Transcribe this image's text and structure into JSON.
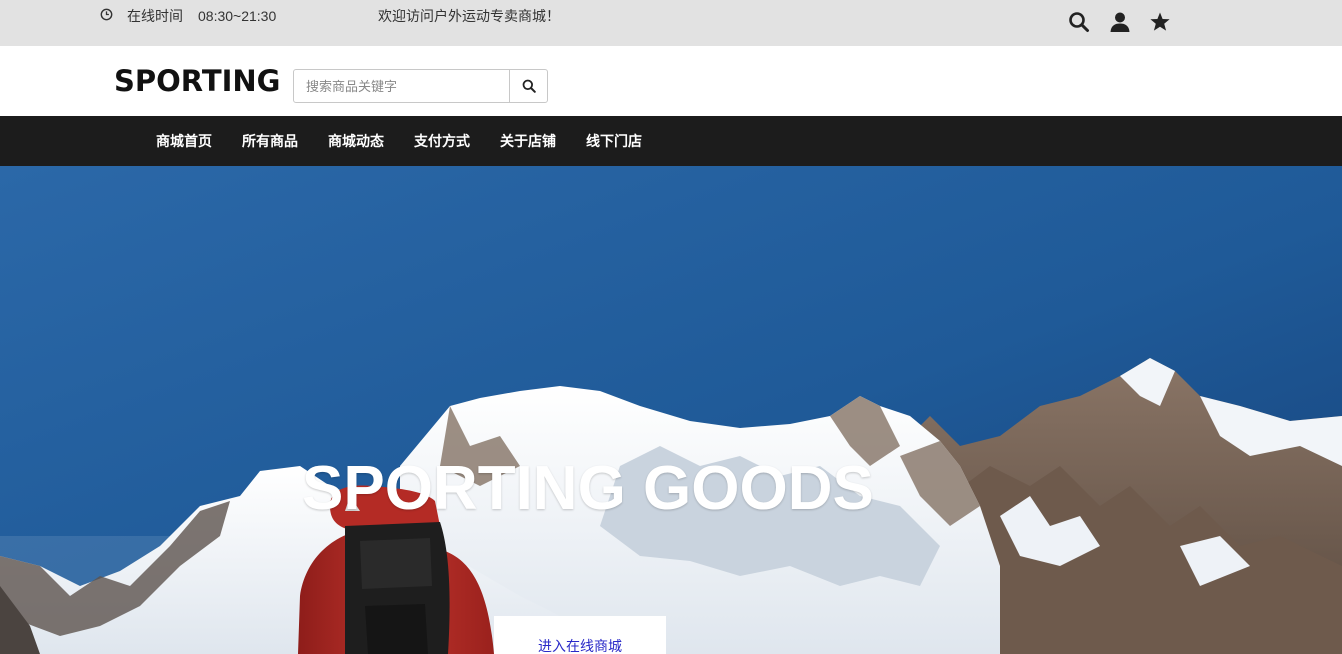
{
  "topbar": {
    "hours_label": "在线时间",
    "hours_value": "08:30~21:30",
    "welcome": "欢迎访问户外运动专卖商城！",
    "icons": [
      "clock-icon",
      "search-icon",
      "user-icon",
      "star-icon"
    ]
  },
  "header": {
    "logo": "SPORTING",
    "search": {
      "placeholder": "搜索商品关键字",
      "value": ""
    }
  },
  "nav": {
    "items": [
      "商城首页",
      "所有商品",
      "商城动态",
      "支付方式",
      "关于店铺",
      "线下门店"
    ]
  },
  "hero": {
    "title": "SPORTING GOODS",
    "cta_label": "进入在线商城"
  },
  "colors": {
    "topbar_bg": "#e2e2e2",
    "nav_bg": "#1c1c1c",
    "cta_text": "#2a2ac8",
    "sky": "#1d4f8a"
  }
}
